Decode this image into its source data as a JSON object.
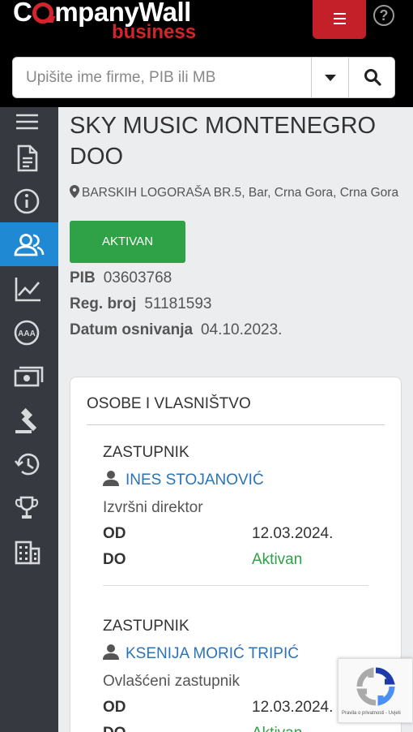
{
  "header": {
    "brand_left": "C",
    "brand_right": "mpanyWall",
    "brand_sub": "business",
    "help_label": "?"
  },
  "search": {
    "placeholder": "Upišite ime firme, PIB ili MB"
  },
  "sidebar": {
    "active_index": 3,
    "items": [
      {
        "icon": "hamburger-icon"
      },
      {
        "icon": "document-icon"
      },
      {
        "icon": "info-icon"
      },
      {
        "icon": "users-icon"
      },
      {
        "icon": "chart-line-icon"
      },
      {
        "icon": "aaa-rating-icon"
      },
      {
        "icon": "money-icon"
      },
      {
        "icon": "gavel-icon"
      },
      {
        "icon": "history-icon"
      },
      {
        "icon": "trophy-icon"
      },
      {
        "icon": "building-icon"
      }
    ]
  },
  "company": {
    "name": "SKY MUSIC MONTENEGRO DOO",
    "address": "BARSKIH LOGORAŠA BR.5, Bar, Crna Gora, Crna Gora",
    "status": "AKTIVAN",
    "pib_label": "PIB",
    "pib": "03603768",
    "reg_label": "Reg. broj",
    "reg": "51181593",
    "founded_label": "Datum osnivanja",
    "founded": "04.10.2023."
  },
  "persons_card": {
    "title": "OSOBE I VLASNIŠTVO",
    "persons": [
      {
        "role": "ZASTUPNIK",
        "name": "INES STOJANOVIĆ",
        "function": "Izvršni direktor",
        "from_label": "OD",
        "from": "12.03.2024.",
        "to_label": "DO",
        "to": "Aktivan"
      },
      {
        "role": "ZASTUPNIK",
        "name": "KSENIJA MORIĆ TRIPIĆ",
        "function": "Ovlašćeni zastupnik",
        "from_label": "OD",
        "from": "12.03.2024.",
        "to_label": "DO",
        "to": "Aktivan"
      }
    ]
  },
  "recaptcha": {
    "text": "Pravila o privatnosti - Uvjeti"
  },
  "colors": {
    "brand_red": "#c4202a",
    "active_blue": "#1f8ad3",
    "status_green": "#2fa146",
    "link_blue": "#2a73b8",
    "sidebar_bg": "#363a40"
  }
}
